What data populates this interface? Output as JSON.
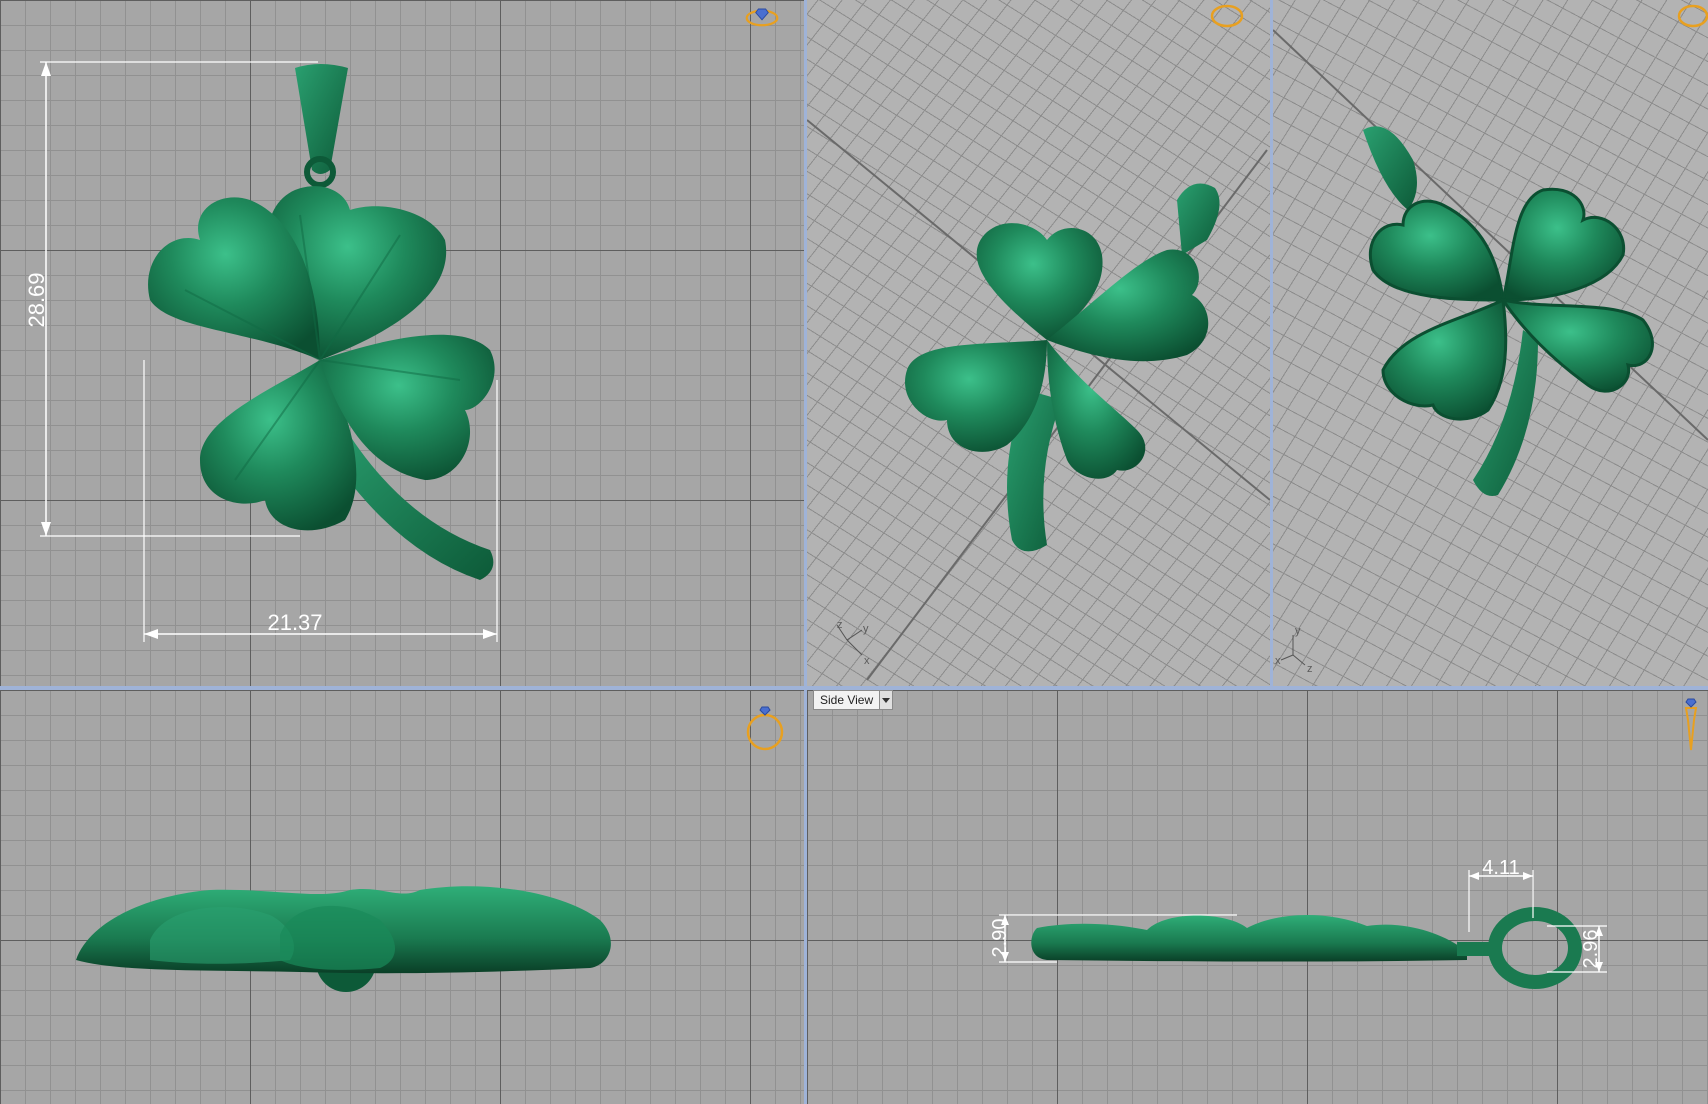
{
  "viewports": {
    "top": {
      "dim_width": "21.37",
      "dim_height": "28.69"
    },
    "side": {
      "menu_label": "Side View",
      "dim_height_left": "2.90",
      "dim_bail_width": "4.11",
      "dim_bail_height": "2.96"
    }
  },
  "axes": {
    "x": "x",
    "y": "y",
    "z": "z"
  },
  "icons": {
    "nav_top": "ring-nav-icon",
    "nav_persp": "ring-nav-icon",
    "nav_persp_b": "ring-nav-icon",
    "nav_front": "ring-nav-icon",
    "nav_side": "ring-nav-icon"
  },
  "colors": {
    "model": "#1f8a5c",
    "model_dark": "#0d5a38",
    "grid_bg": "#a6a6a6",
    "dimension": "#ffffff",
    "nav_icon": "#e8a020",
    "divider": "#9fb3d8"
  }
}
